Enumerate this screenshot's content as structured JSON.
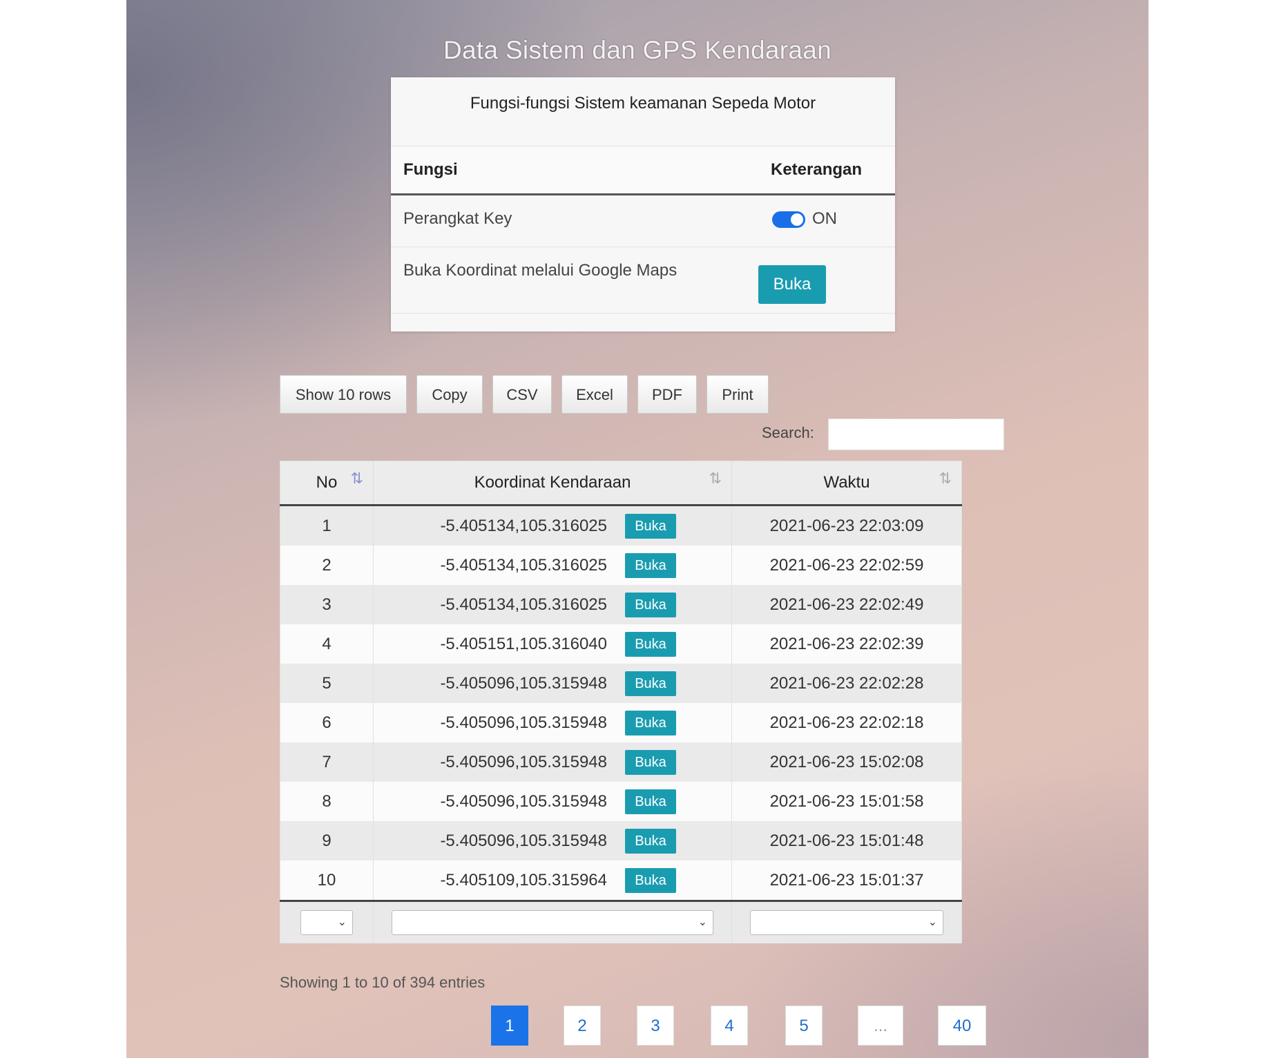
{
  "page_title": "Data Sistem dan GPS Kendaraan",
  "card": {
    "header": "Fungsi-fungsi Sistem keamanan Sepeda Motor",
    "col_fungsi": "Fungsi",
    "col_keterangan": "Keterangan",
    "rows": [
      {
        "label": "Perangkat Key",
        "toggle_state": "ON"
      },
      {
        "label": "Buka Koordinat melalui Google Maps",
        "button": "Buka"
      }
    ]
  },
  "toolbar": {
    "show_rows": "Show 10 rows",
    "copy": "Copy",
    "csv": "CSV",
    "excel": "Excel",
    "pdf": "PDF",
    "print": "Print"
  },
  "search": {
    "label": "Search:",
    "value": "",
    "placeholder": ""
  },
  "table": {
    "headers": [
      "No",
      "Koordinat Kendaraan",
      "Waktu"
    ],
    "sort_icon": "⇅",
    "rows": [
      {
        "no": "1",
        "koordinat": "-5.405134,105.316025",
        "button": "Buka",
        "waktu": "2021-06-23 22:03:09"
      },
      {
        "no": "2",
        "koordinat": "-5.405134,105.316025",
        "button": "Buka",
        "waktu": "2021-06-23 22:02:59"
      },
      {
        "no": "3",
        "koordinat": "-5.405134,105.316025",
        "button": "Buka",
        "waktu": "2021-06-23 22:02:49"
      },
      {
        "no": "4",
        "koordinat": "-5.405151,105.316040",
        "button": "Buka",
        "waktu": "2021-06-23 22:02:39"
      },
      {
        "no": "5",
        "koordinat": "-5.405096,105.315948",
        "button": "Buka",
        "waktu": "2021-06-23 22:02:28"
      },
      {
        "no": "6",
        "koordinat": "-5.405096,105.315948",
        "button": "Buka",
        "waktu": "2021-06-23 22:02:18"
      },
      {
        "no": "7",
        "koordinat": "-5.405096,105.315948",
        "button": "Buka",
        "waktu": "2021-06-23 15:02:08"
      },
      {
        "no": "8",
        "koordinat": "-5.405096,105.315948",
        "button": "Buka",
        "waktu": "2021-06-23 15:01:58"
      },
      {
        "no": "9",
        "koordinat": "-5.405096,105.315948",
        "button": "Buka",
        "waktu": "2021-06-23 15:01:48"
      },
      {
        "no": "10",
        "koordinat": "-5.405109,105.315964",
        "button": "Buka",
        "waktu": "2021-06-23 15:01:37"
      }
    ]
  },
  "info": "Showing 1 to 10 of 394 entries",
  "pagination": [
    "1",
    "2",
    "3",
    "4",
    "5",
    "...",
    "40"
  ],
  "colors": {
    "accent": "#1a73e8",
    "button": "#1a9cb0"
  }
}
